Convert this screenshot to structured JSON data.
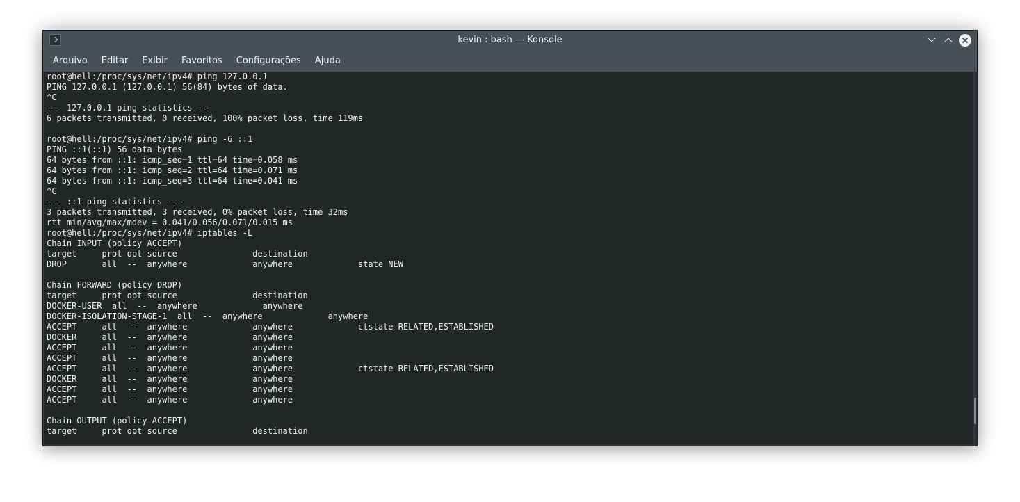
{
  "window": {
    "title": "kevin : bash — Konsole"
  },
  "menu": {
    "items": [
      "Arquivo",
      "Editar",
      "Exibir",
      "Favoritos",
      "Configurações",
      "Ajuda"
    ]
  },
  "icons": {
    "app": "konsole-icon",
    "minimize": "chevron-down-icon",
    "maximize": "chevron-up-icon",
    "close": "close-icon"
  },
  "terminal": {
    "lines": [
      "root@hell:/proc/sys/net/ipv4# ping 127.0.0.1",
      "PING 127.0.0.1 (127.0.0.1) 56(84) bytes of data.",
      "^C",
      "--- 127.0.0.1 ping statistics ---",
      "6 packets transmitted, 0 received, 100% packet loss, time 119ms",
      "",
      "root@hell:/proc/sys/net/ipv4# ping -6 ::1",
      "PING ::1(::1) 56 data bytes",
      "64 bytes from ::1: icmp_seq=1 ttl=64 time=0.058 ms",
      "64 bytes from ::1: icmp_seq=2 ttl=64 time=0.071 ms",
      "64 bytes from ::1: icmp_seq=3 ttl=64 time=0.041 ms",
      "^C",
      "--- ::1 ping statistics ---",
      "3 packets transmitted, 3 received, 0% packet loss, time 32ms",
      "rtt min/avg/max/mdev = 0.041/0.056/0.071/0.015 ms",
      "root@hell:/proc/sys/net/ipv4# iptables -L",
      "Chain INPUT (policy ACCEPT)",
      "target     prot opt source               destination",
      "DROP       all  --  anywhere             anywhere             state NEW",
      "",
      "Chain FORWARD (policy DROP)",
      "target     prot opt source               destination",
      "DOCKER-USER  all  --  anywhere             anywhere",
      "DOCKER-ISOLATION-STAGE-1  all  --  anywhere             anywhere",
      "ACCEPT     all  --  anywhere             anywhere             ctstate RELATED,ESTABLISHED",
      "DOCKER     all  --  anywhere             anywhere",
      "ACCEPT     all  --  anywhere             anywhere",
      "ACCEPT     all  --  anywhere             anywhere",
      "ACCEPT     all  --  anywhere             anywhere             ctstate RELATED,ESTABLISHED",
      "DOCKER     all  --  anywhere             anywhere",
      "ACCEPT     all  --  anywhere             anywhere",
      "ACCEPT     all  --  anywhere             anywhere",
      "",
      "Chain OUTPUT (policy ACCEPT)",
      "target     prot opt source               destination"
    ]
  },
  "colors": {
    "titlebar": "#475057",
    "terminal_bg": "#232627",
    "terminal_fg": "#eff0f1"
  }
}
